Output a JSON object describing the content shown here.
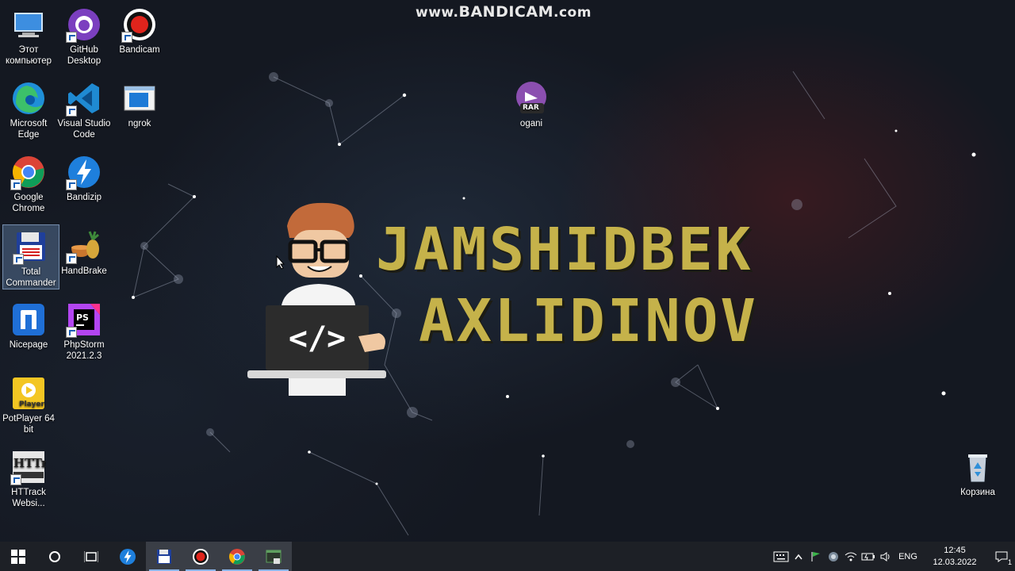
{
  "watermark": {
    "prefix": "www.",
    "brand": "BANDICAM",
    "suffix": ".com"
  },
  "desktop": {
    "icons": [
      {
        "label": "Этот компьютер",
        "icon": "this-pc-icon"
      },
      {
        "label": "GitHub Desktop",
        "icon": "github-desktop-icon"
      },
      {
        "label": "Bandicam",
        "icon": "bandicam-icon"
      },
      {
        "label": "Microsoft Edge",
        "icon": "edge-icon"
      },
      {
        "label": "Visual Studio Code",
        "icon": "vscode-icon"
      },
      {
        "label": "ngrok",
        "icon": "ngrok-icon"
      },
      {
        "label": "Google Chrome",
        "icon": "chrome-icon"
      },
      {
        "label": "Bandizip",
        "icon": "bandizip-icon"
      },
      {
        "label": "Total Commander",
        "icon": "total-commander-icon"
      },
      {
        "label": "HandBrake",
        "icon": "handbrake-icon"
      },
      {
        "label": "Nicepage",
        "icon": "nicepage-icon"
      },
      {
        "label": "PhpStorm 2021.2.3",
        "icon": "phpstorm-icon"
      },
      {
        "label": "PotPlayer 64 bit",
        "icon": "potplayer-icon"
      },
      {
        "label": "HTTrack Websi...",
        "icon": "httrack-icon"
      },
      {
        "label": "ogani",
        "icon": "winrar-archive-icon",
        "badge": "RAR"
      },
      {
        "label": "Корзина",
        "icon": "recycle-bin-icon"
      }
    ]
  },
  "wallpaper": {
    "line1": "JAMSHIDBEK",
    "line2": "AXLIDINOV",
    "code_symbol": "</>",
    "accent": "#c5b24a"
  },
  "taskbar": {
    "items": [
      "start-icon",
      "search-icon",
      "task-view-icon",
      "bandizip-icon",
      "total-commander-icon",
      "bandicam-icon",
      "chrome-icon",
      "terminal-icon"
    ],
    "tray": {
      "language": "ENG",
      "time": "12:45",
      "date": "12.03.2022",
      "notification_count": "1"
    }
  }
}
